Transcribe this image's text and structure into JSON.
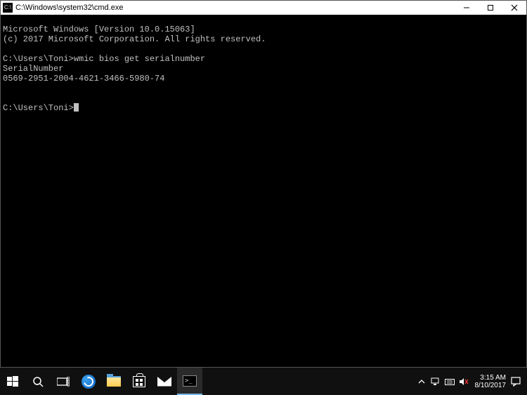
{
  "window": {
    "title": "C:\\Windows\\system32\\cmd.exe",
    "icon_label": "C:\\"
  },
  "terminal": {
    "line1": "Microsoft Windows [Version 10.0.15063]",
    "line2": "(c) 2017 Microsoft Corporation. All rights reserved.",
    "blank1": "",
    "prompt1": "C:\\Users\\Toni>",
    "cmd1": "wmic bios get serialnumber",
    "out_header": "SerialNumber",
    "out_value": "0569-2951-2004-4621-3466-5980-74",
    "blank2": "",
    "blank3": "",
    "prompt2": "C:\\Users\\Toni>"
  },
  "taskbar": {
    "clock_time": "3:15 AM",
    "clock_date": "8/10/2017"
  }
}
